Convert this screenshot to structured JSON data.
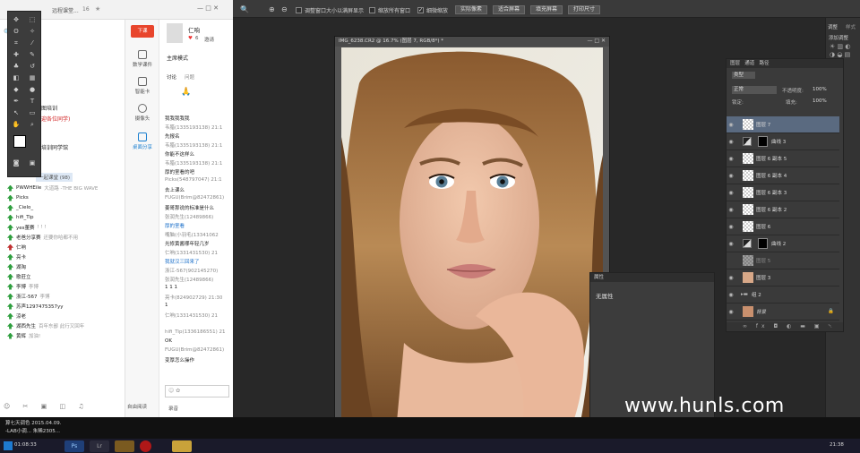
{
  "ps_options": {
    "checkbox_resize": "调整窗口大小以满屏显示",
    "checkbox_zoom_all": "缩放所有窗口",
    "checkbox_scrubby": "细微缩放",
    "btn_actual": "实际像素",
    "btn_fit": "适合屏幕",
    "btn_fill": "填充屏幕",
    "btn_print": "打印尺寸"
  },
  "chat": {
    "title": "远程课堂...",
    "count": "16",
    "star": "★",
    "group_name": "仁响",
    "likes": "6",
    "invite": "邀请",
    "section_owner": "主席模式",
    "tab_discuss": "讨论",
    "tab_question": "问题",
    "side": [
      "数学课件",
      "智能卡",
      "摄像头",
      "桌面分享"
    ],
    "call_btn": "下课",
    "notice_1": "能图培训",
    "notice_2": "欢迎各位同学)",
    "notice_3": "图培训同学馆",
    "contacts_header": "一起课堂 (98)",
    "contacts": [
      {
        "name": "PWWHEile",
        "sub": "大道路 -THE BIG WAVE"
      },
      {
        "name": "Picks",
        "sub": ""
      },
      {
        "name": "_Cielo_",
        "sub": ""
      },
      {
        "name": "hifi_Tip",
        "sub": ""
      },
      {
        "name": "yes董赛",
        "sub": "! ! !"
      },
      {
        "name": "老爸分享赛",
        "sub": "还要你哈都不用"
      },
      {
        "name": "仁响",
        "sub": ""
      },
      {
        "name": "亮卡",
        "sub": ""
      },
      {
        "name": "湖淘",
        "sub": ""
      },
      {
        "name": "歌莊立",
        "sub": ""
      },
      {
        "name": "李博",
        "sub": "李博"
      },
      {
        "name": "浙江-567",
        "sub": "李博"
      },
      {
        "name": "苏声1297475357yy",
        "sub": ""
      },
      {
        "name": "涼老",
        "sub": ""
      },
      {
        "name": "湖西先生",
        "sub": "百年东鄙 此行又回年"
      },
      {
        "name": "黄辉",
        "sub": "加油!"
      }
    ],
    "messages": [
      {
        "t": "我我我我我",
        "b": true
      },
      {
        "t": "韦腊(1335193138) 21:1",
        "b": false
      },
      {
        "t": "先报名",
        "b": true
      },
      {
        "t": "韦腊(1335193138) 21:1",
        "b": false
      },
      {
        "t": "你能不这样么",
        "b": true
      },
      {
        "t": "韦腊(1335193138) 21:1",
        "b": false
      },
      {
        "t": "厚的室看的吧",
        "b": true
      },
      {
        "t": "Picks(548797047) 21:1",
        "b": false
      },
      {
        "t": "去上课么",
        "b": true
      },
      {
        "t": "FUGU(Brim@82472861)",
        "b": false
      },
      {
        "t": "姜哥那说的标准是什么",
        "b": true
      },
      {
        "t": "张润先生(12489866)",
        "b": false
      },
      {
        "t": "厚的室看",
        "b": true
      },
      {
        "t": "嘴脑(小羽毛(13341062",
        "b": false
      },
      {
        "t": "光修黄酱哪年轻几岁",
        "b": true
      },
      {
        "t": "仁响(1331431530) 21",
        "b": false
      },
      {
        "t": "我就汉三回来了",
        "b": true
      },
      {
        "t": "浙江-567(902145270)",
        "b": false
      },
      {
        "t": "张润先生(12489866)",
        "b": false
      },
      {
        "t": "1 1 1",
        "b": true
      },
      {
        "t": "亮卡(824902729) 21:30",
        "b": false
      },
      {
        "t": "1",
        "b": true
      },
      {
        "t": "仁响(1331431530) 21",
        "b": false
      },
      {
        "t": "hifi_Tip(1336186551) 21",
        "b": false
      },
      {
        "t": "OK",
        "b": true
      },
      {
        "t": "FUGU(Brim@82472861)",
        "b": false
      },
      {
        "t": "变厚怎么操作",
        "b": true
      }
    ],
    "bottom_btn_1": "自由阅读",
    "bottom_btn_2": "录音"
  },
  "taskinfo": {
    "line1": "算七天调色  2015.04.09.",
    "line2": "-LAB小调...  朱稀2305..."
  },
  "taskbar": {
    "time": "21:38",
    "clock_left": "01:08:33"
  },
  "doc": {
    "title": "IMG_6238.CR2 @ 16.7% (图层 7, RGB/8*) *"
  },
  "props": {
    "tab": "属性",
    "none": "无属性"
  },
  "layers": {
    "tabs": [
      "图层",
      "通道",
      "路径"
    ],
    "kind": "类型",
    "blend": "正常",
    "opacity_label": "不透明度:",
    "opacity": "100%",
    "lock": "锁定:",
    "fill_label": "填充:",
    "fill": "100%",
    "items": [
      {
        "name": "图层 7",
        "kind": "layer"
      },
      {
        "name": "曲线 3",
        "kind": "adj"
      },
      {
        "name": "图层 6 副本 5",
        "kind": "layer"
      },
      {
        "name": "图层 6 副本 4",
        "kind": "layer"
      },
      {
        "name": "图层 6 副本 3",
        "kind": "layer"
      },
      {
        "name": "图层 6 副本 2",
        "kind": "layer"
      },
      {
        "name": "图层 6",
        "kind": "layer"
      },
      {
        "name": "曲线 2",
        "kind": "adj"
      },
      {
        "name": "图层 5",
        "kind": "layer"
      },
      {
        "name": "图层 3",
        "kind": "layer"
      },
      {
        "name": "组 2",
        "kind": "group"
      },
      {
        "name": "背景",
        "kind": "bg"
      }
    ]
  },
  "right_dock": {
    "tab1": "调整",
    "tab2": "样式",
    "add": "添加调整"
  },
  "watermark": "www.hunls.com"
}
